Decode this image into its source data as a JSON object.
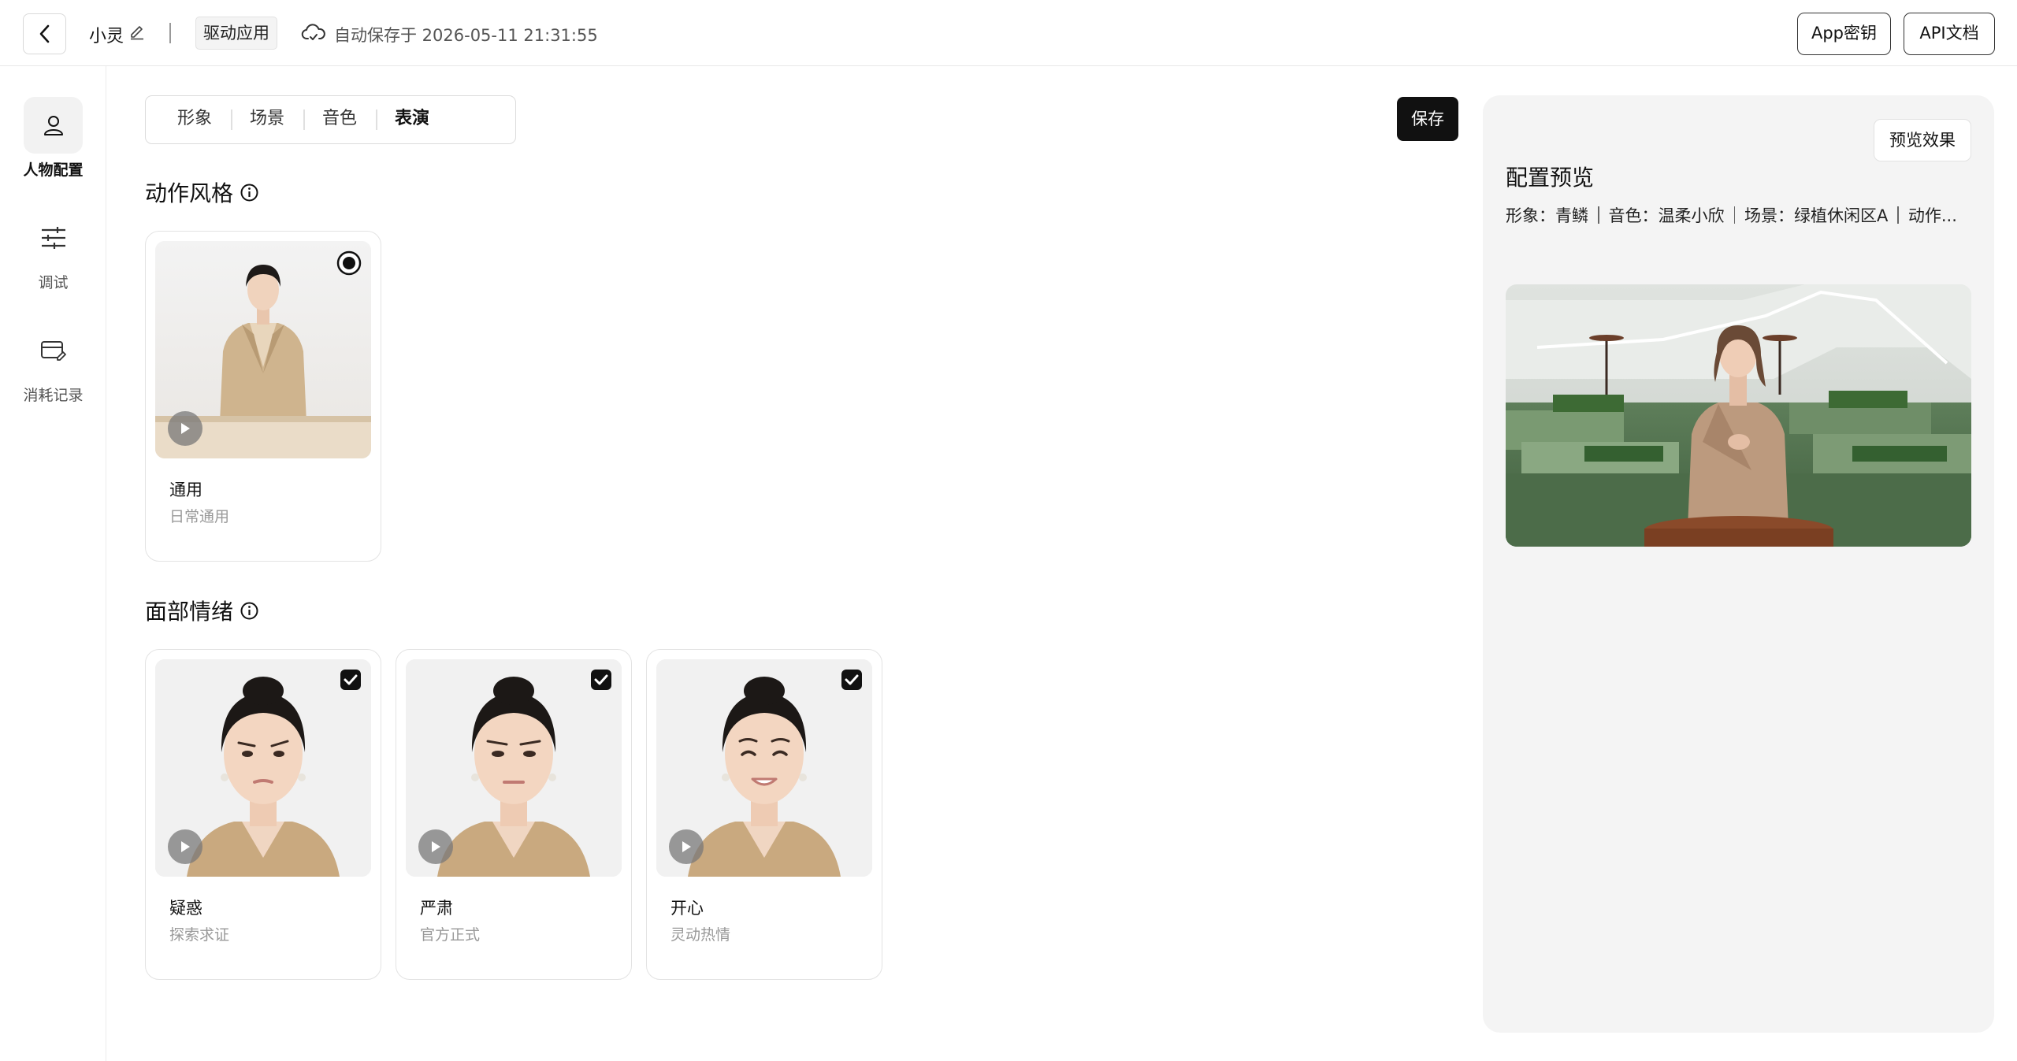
{
  "header": {
    "back_icon": "chevron-left-icon",
    "app_name": "小灵",
    "edit_icon": "pencil-icon",
    "tag": "驱动应用",
    "cloud_icon": "cloud-sync-icon",
    "autosave_text": "自动保存于 2026-05-11 21:31:55",
    "app_key_label": "App密钥",
    "api_doc_label": "API文档"
  },
  "sidebar": {
    "items": [
      {
        "label": "人物配置",
        "icon": "person-icon",
        "active": true
      },
      {
        "label": "调试",
        "icon": "sliders-icon",
        "active": false
      },
      {
        "label": "消耗记录",
        "icon": "card-edit-icon",
        "active": false
      }
    ]
  },
  "tabs": [
    {
      "label": "形象",
      "active": false
    },
    {
      "label": "场景",
      "active": false
    },
    {
      "label": "音色",
      "active": false
    },
    {
      "label": "表演",
      "active": true
    }
  ],
  "save_label": "保存",
  "action_style": {
    "title": "动作风格",
    "cards": [
      {
        "title": "通用",
        "subtitle": "日常通用",
        "selected": true
      }
    ]
  },
  "facial_emotion": {
    "title": "面部情绪",
    "cards": [
      {
        "title": "疑惑",
        "subtitle": "探索求证",
        "checked": true
      },
      {
        "title": "严肃",
        "subtitle": "官方正式",
        "checked": true
      },
      {
        "title": "开心",
        "subtitle": "灵动热情",
        "checked": true
      }
    ]
  },
  "preview": {
    "effect_button": "预览效果",
    "title": "配置预览",
    "summary": [
      "形象：青鳞",
      "音色：温柔小欣",
      "场景：绿植休闲区A",
      "动作..."
    ]
  },
  "colors": {
    "primary": "#111111",
    "panel_bg": "#f4f4f4",
    "border": "#e3e3e3",
    "muted_text": "#999999"
  }
}
